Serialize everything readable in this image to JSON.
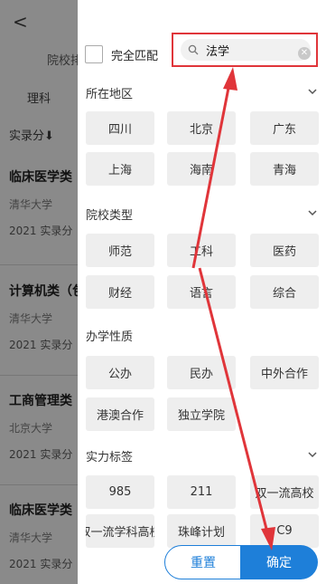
{
  "background": {
    "back_glyph": "<",
    "school_label": "院校排",
    "tab_label": "理科",
    "sort_label": "实录分⬇",
    "items": [
      {
        "title": "临床医学类",
        "university": "清华大学",
        "year_score": "2021  实录分"
      },
      {
        "title": "计算机类（包",
        "university": "清华大学",
        "year_score": "2021  实录分"
      },
      {
        "title": "工商管理类",
        "university": "北京大学",
        "year_score": "2021  实录分"
      },
      {
        "title": "临床医学类",
        "university": "清华大学",
        "year_score": "2021  实录分"
      }
    ]
  },
  "filter": {
    "exact_match_label": "完全匹配",
    "search": {
      "value": "法学",
      "placeholder": ""
    },
    "sections": {
      "region": {
        "title": "所在地区",
        "options": [
          "四川",
          "北京",
          "广东",
          "上海",
          "海南",
          "青海"
        ]
      },
      "school_type": {
        "title": "院校类型",
        "options": [
          "师范",
          "工科",
          "医药",
          "财经",
          "语言",
          "综合"
        ]
      },
      "ownership": {
        "title": "办学性质",
        "options": [
          "公办",
          "民办",
          "中外合作",
          "港澳合作",
          "独立学院"
        ]
      },
      "strength": {
        "title": "实力标签",
        "options": [
          "985",
          "211",
          "双一流高校",
          "双一流学科高校",
          "珠峰计划",
          "C9"
        ]
      }
    },
    "buttons": {
      "reset": "重置",
      "confirm": "确定"
    }
  },
  "colors": {
    "accent": "#1e7fd9",
    "annotation": "#e0353a",
    "chip_bg": "#eeeeee",
    "overlay": "#8a8a8a"
  }
}
